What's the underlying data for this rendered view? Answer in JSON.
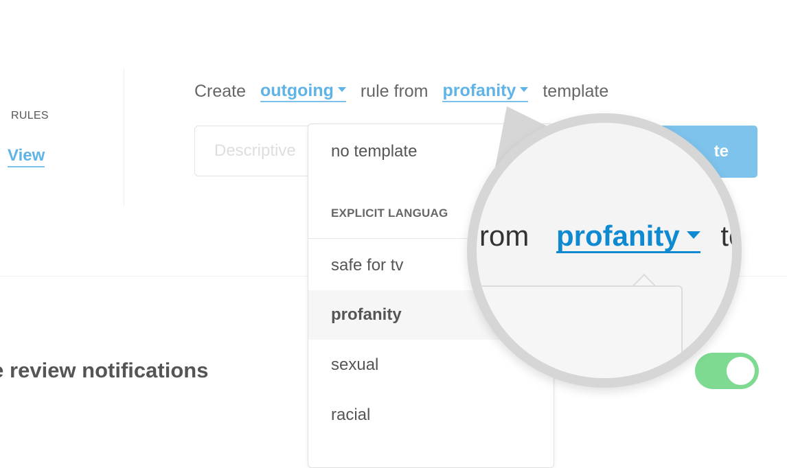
{
  "sidebar": {
    "section_label": "RULES",
    "view_link": "View"
  },
  "create_rule": {
    "word_create": "Create",
    "direction_value": "outgoing",
    "word_rule_from": "rule from",
    "template_value": "profanity",
    "word_template": "template",
    "description_placeholder": "Descriptive",
    "create_button_label": "te"
  },
  "template_menu": {
    "no_template_label": "no template",
    "group_label": "EXPLICIT LANGUAG",
    "items": [
      "safe for tv",
      "profanity",
      "sexual",
      "racial"
    ],
    "selected_index": 1
  },
  "settings": {
    "notifications_label": "age review notifications",
    "notifications_enabled": true
  },
  "magnifier": {
    "prefix_text": "rom",
    "dropdown_value": "profanity",
    "suffix_text": "ter",
    "partial_text": "e"
  },
  "colors": {
    "accent": "#5fb3e6",
    "accent_dark": "#0f8ad1",
    "toggle_on": "#7ed991",
    "button_bg": "#7ec3ec"
  },
  "icons": {
    "dropdown_caret": "caret-down-icon"
  }
}
